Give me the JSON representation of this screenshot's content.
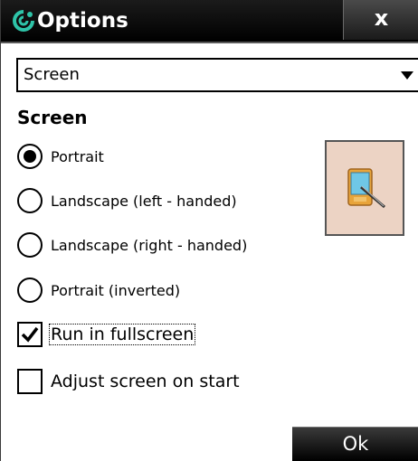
{
  "window": {
    "title": "Options",
    "close_label": "x"
  },
  "dropdown": {
    "selected": "Screen"
  },
  "section": {
    "heading": "Screen"
  },
  "orientation": {
    "options": [
      {
        "label": "Portrait",
        "checked": true
      },
      {
        "label": "Landscape (left - handed)",
        "checked": false
      },
      {
        "label": "Landscape (right - handed)",
        "checked": false
      },
      {
        "label": "Portrait (inverted)",
        "checked": false
      }
    ]
  },
  "settings": {
    "fullscreen": {
      "label": "Run in fullscreen",
      "checked": true
    },
    "adjust": {
      "label": "Adjust screen on start",
      "checked": false
    }
  },
  "buttons": {
    "ok_label": "Ok"
  },
  "colors": {
    "titlebar": "#000000",
    "accent": "#2ec4a8",
    "preview_bg": "#ecd3c4"
  }
}
